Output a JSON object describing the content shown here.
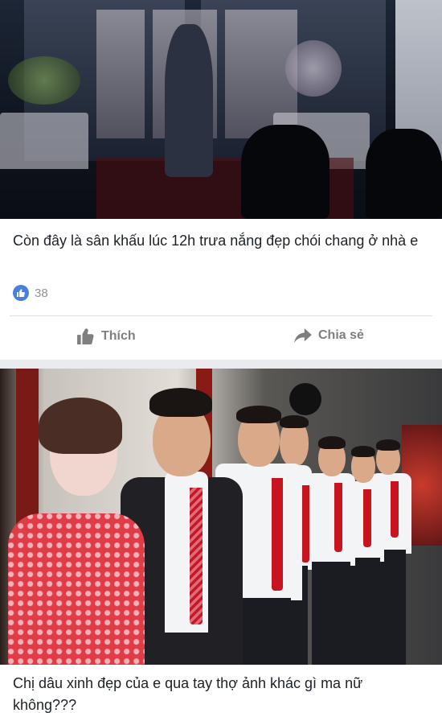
{
  "posts": [
    {
      "caption": "Còn đây là sân khấu lúc 12h trưa nắng đẹp chói chang ở nhà e",
      "like_count": "38",
      "actions": {
        "like_label": "Thích",
        "share_label": "Chia sẻ"
      },
      "photo": {
        "icon": "stage-photo"
      }
    },
    {
      "caption": "Chị dâu xinh đẹp của e qua tay thợ ảnh khác gì ma nữ không???",
      "photo": {
        "icon": "wedding-photo"
      }
    }
  ],
  "colors": {
    "like_blue": "#4a7fdc",
    "action_gray": "#7f7f7f",
    "feed_bg": "#e9ebee",
    "text": "#1d2129"
  }
}
